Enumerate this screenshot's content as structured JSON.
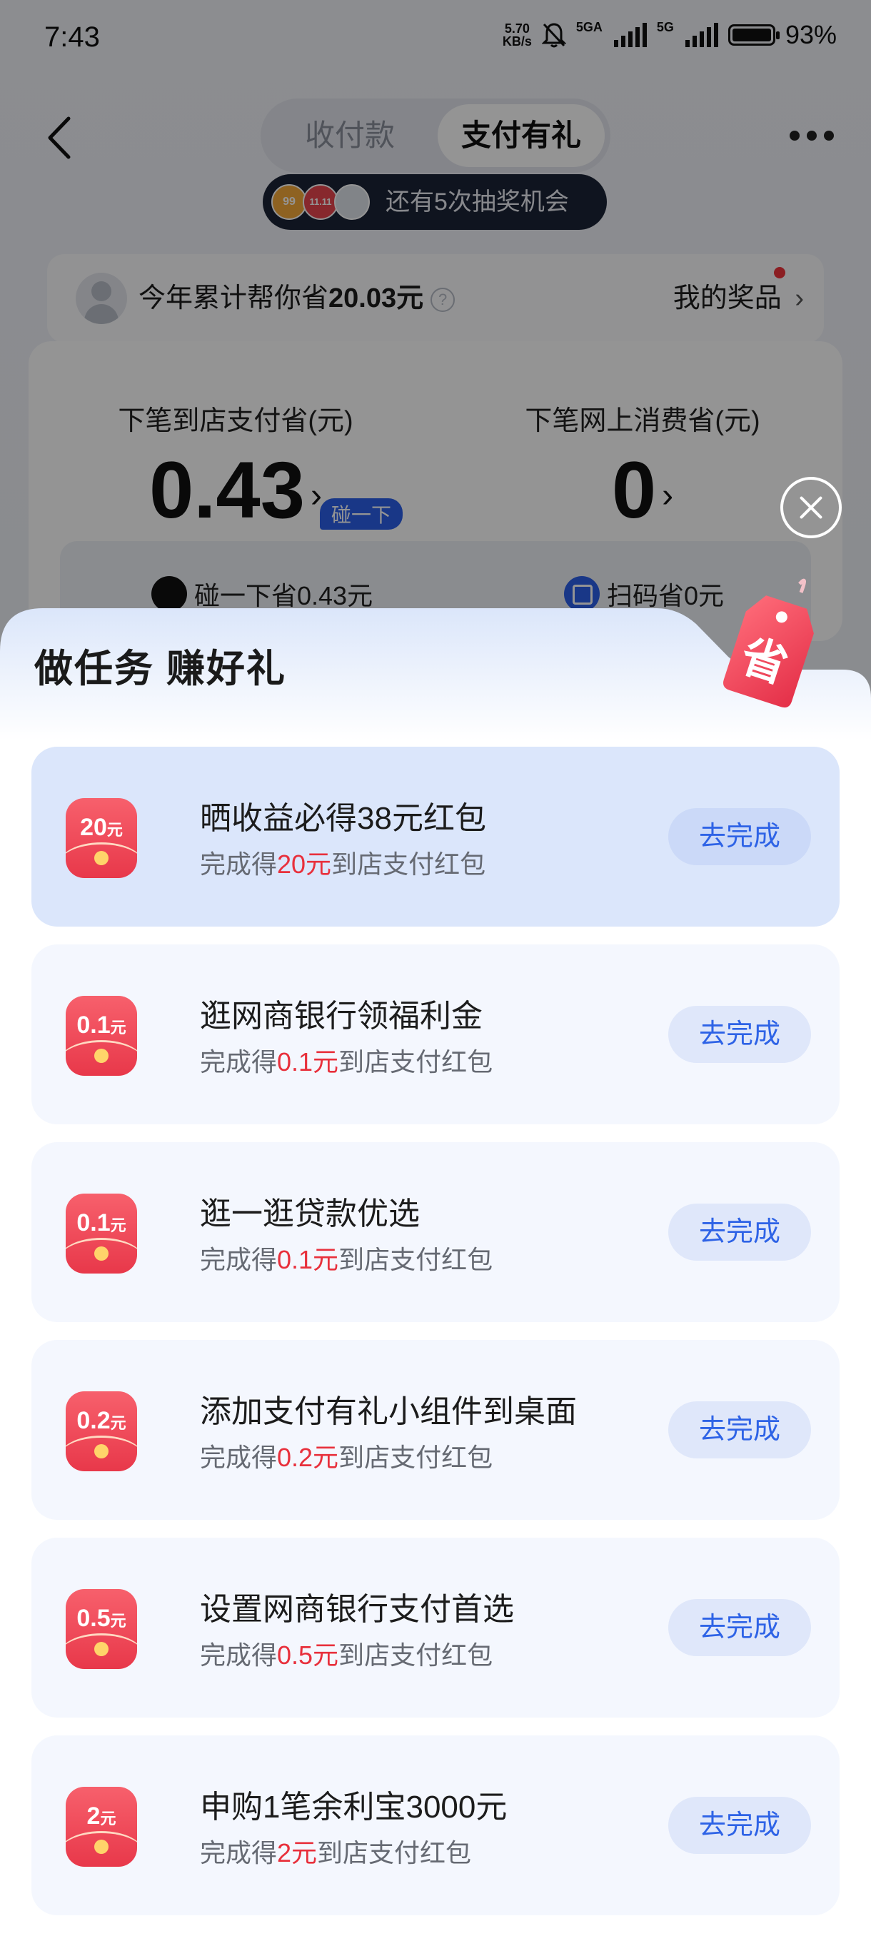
{
  "status_bar": {
    "time": "7:43",
    "net_speed_top": "5.70",
    "net_speed_bottom": "KB/s",
    "sim1": "5GA",
    "sim2": "5G",
    "battery": "93%"
  },
  "nav": {
    "tab_inactive": "收付款",
    "tab_active": "支付有礼"
  },
  "lottery": {
    "badge1": "99",
    "badge2": "11.11",
    "text": "还有5次抽奖机会"
  },
  "savings": {
    "prefix": "今年累计帮你省",
    "amount": "20.03元",
    "help": "?",
    "prizes_label": "我的奖品",
    "prizes_chevron": "›"
  },
  "stats": {
    "store_label": "下笔到店支付省(元)",
    "store_value": "0.43",
    "touch_tag": "碰一下",
    "online_label": "下笔网上消费省(元)",
    "online_value": "0",
    "chevron": "›",
    "touch_saving": "碰一下省0.43元",
    "scan_saving": "扫码省0元"
  },
  "sheet": {
    "title": "做任务 赚好礼",
    "badge_char": "省",
    "tasks": [
      {
        "amount_num": "20",
        "amount_unit": "元",
        "title": "晒收益必得38元红包",
        "desc_prefix": "完成得",
        "desc_amount": "20元",
        "desc_suffix": "到店支付红包",
        "button": "去完成"
      },
      {
        "amount_num": "0.1",
        "amount_unit": "元",
        "title": "逛网商银行领福利金",
        "desc_prefix": "完成得",
        "desc_amount": "0.1元",
        "desc_suffix": "到店支付红包",
        "button": "去完成"
      },
      {
        "amount_num": "0.1",
        "amount_unit": "元",
        "title": "逛一逛贷款优选",
        "desc_prefix": "完成得",
        "desc_amount": "0.1元",
        "desc_suffix": "到店支付红包",
        "button": "去完成"
      },
      {
        "amount_num": "0.2",
        "amount_unit": "元",
        "title": "添加支付有礼小组件到桌面",
        "desc_prefix": "完成得",
        "desc_amount": "0.2元",
        "desc_suffix": "到店支付红包",
        "button": "去完成"
      },
      {
        "amount_num": "0.5",
        "amount_unit": "元",
        "title": "设置网商银行支付首选",
        "desc_prefix": "完成得",
        "desc_amount": "0.5元",
        "desc_suffix": "到店支付红包",
        "button": "去完成"
      },
      {
        "amount_num": "2",
        "amount_unit": "元",
        "title": "申购1笔余利宝3000元",
        "desc_prefix": "完成得",
        "desc_amount": "2元",
        "desc_suffix": "到店支付红包",
        "button": "去完成"
      }
    ]
  },
  "colors": {
    "accent_blue": "#2e63e6",
    "highlight_red": "#e8303c",
    "envelope_red": "#ee4656"
  }
}
